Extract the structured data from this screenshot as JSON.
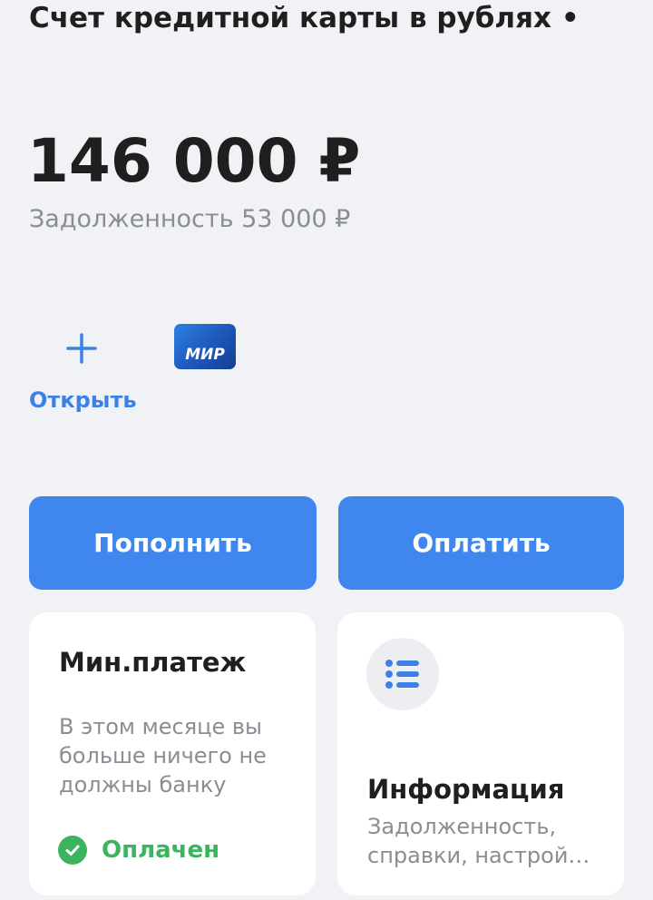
{
  "account": {
    "title": "Счет кредитной карты в рублях •",
    "balance": "146 000 ₽",
    "debt": "Задолженность 53 000 ₽"
  },
  "cards": {
    "open_label": "Открыть",
    "open_icon": "plus-icon",
    "mir_card_text": "МИР"
  },
  "actions": {
    "topup_label": "Пополнить",
    "pay_label": "Оплатить"
  },
  "min_payment": {
    "title": "Мин.платеж",
    "description": "В этом месяце вы больше ничего не должны банку",
    "status_label": "Оплачен",
    "status_icon": "check-circle-icon"
  },
  "info": {
    "icon": "list-icon",
    "title": "Информация",
    "description_line1": "Задолженность,",
    "description_line2": "справки, настрой…"
  },
  "colors": {
    "accent": "#3f87ee",
    "link": "#3c82e6",
    "success": "#3db35f",
    "secondary_text": "#8a8d94",
    "background": "#f1f2f6"
  }
}
